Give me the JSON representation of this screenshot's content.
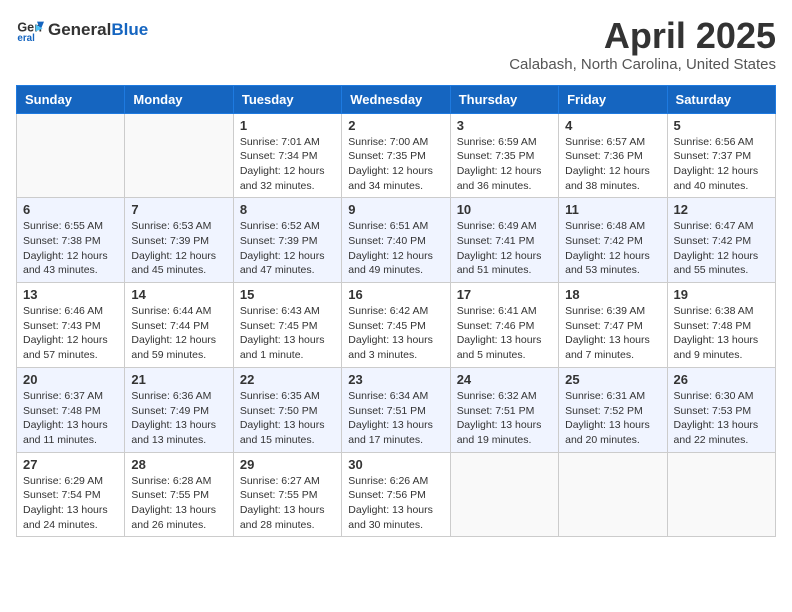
{
  "header": {
    "logo_general": "General",
    "logo_blue": "Blue",
    "title": "April 2025",
    "subtitle": "Calabash, North Carolina, United States"
  },
  "calendar": {
    "days_of_week": [
      "Sunday",
      "Monday",
      "Tuesday",
      "Wednesday",
      "Thursday",
      "Friday",
      "Saturday"
    ],
    "weeks": [
      [
        {
          "day": "",
          "info": ""
        },
        {
          "day": "",
          "info": ""
        },
        {
          "day": "1",
          "info": "Sunrise: 7:01 AM\nSunset: 7:34 PM\nDaylight: 12 hours\nand 32 minutes."
        },
        {
          "day": "2",
          "info": "Sunrise: 7:00 AM\nSunset: 7:35 PM\nDaylight: 12 hours\nand 34 minutes."
        },
        {
          "day": "3",
          "info": "Sunrise: 6:59 AM\nSunset: 7:35 PM\nDaylight: 12 hours\nand 36 minutes."
        },
        {
          "day": "4",
          "info": "Sunrise: 6:57 AM\nSunset: 7:36 PM\nDaylight: 12 hours\nand 38 minutes."
        },
        {
          "day": "5",
          "info": "Sunrise: 6:56 AM\nSunset: 7:37 PM\nDaylight: 12 hours\nand 40 minutes."
        }
      ],
      [
        {
          "day": "6",
          "info": "Sunrise: 6:55 AM\nSunset: 7:38 PM\nDaylight: 12 hours\nand 43 minutes."
        },
        {
          "day": "7",
          "info": "Sunrise: 6:53 AM\nSunset: 7:39 PM\nDaylight: 12 hours\nand 45 minutes."
        },
        {
          "day": "8",
          "info": "Sunrise: 6:52 AM\nSunset: 7:39 PM\nDaylight: 12 hours\nand 47 minutes."
        },
        {
          "day": "9",
          "info": "Sunrise: 6:51 AM\nSunset: 7:40 PM\nDaylight: 12 hours\nand 49 minutes."
        },
        {
          "day": "10",
          "info": "Sunrise: 6:49 AM\nSunset: 7:41 PM\nDaylight: 12 hours\nand 51 minutes."
        },
        {
          "day": "11",
          "info": "Sunrise: 6:48 AM\nSunset: 7:42 PM\nDaylight: 12 hours\nand 53 minutes."
        },
        {
          "day": "12",
          "info": "Sunrise: 6:47 AM\nSunset: 7:42 PM\nDaylight: 12 hours\nand 55 minutes."
        }
      ],
      [
        {
          "day": "13",
          "info": "Sunrise: 6:46 AM\nSunset: 7:43 PM\nDaylight: 12 hours\nand 57 minutes."
        },
        {
          "day": "14",
          "info": "Sunrise: 6:44 AM\nSunset: 7:44 PM\nDaylight: 12 hours\nand 59 minutes."
        },
        {
          "day": "15",
          "info": "Sunrise: 6:43 AM\nSunset: 7:45 PM\nDaylight: 13 hours\nand 1 minute."
        },
        {
          "day": "16",
          "info": "Sunrise: 6:42 AM\nSunset: 7:45 PM\nDaylight: 13 hours\nand 3 minutes."
        },
        {
          "day": "17",
          "info": "Sunrise: 6:41 AM\nSunset: 7:46 PM\nDaylight: 13 hours\nand 5 minutes."
        },
        {
          "day": "18",
          "info": "Sunrise: 6:39 AM\nSunset: 7:47 PM\nDaylight: 13 hours\nand 7 minutes."
        },
        {
          "day": "19",
          "info": "Sunrise: 6:38 AM\nSunset: 7:48 PM\nDaylight: 13 hours\nand 9 minutes."
        }
      ],
      [
        {
          "day": "20",
          "info": "Sunrise: 6:37 AM\nSunset: 7:48 PM\nDaylight: 13 hours\nand 11 minutes."
        },
        {
          "day": "21",
          "info": "Sunrise: 6:36 AM\nSunset: 7:49 PM\nDaylight: 13 hours\nand 13 minutes."
        },
        {
          "day": "22",
          "info": "Sunrise: 6:35 AM\nSunset: 7:50 PM\nDaylight: 13 hours\nand 15 minutes."
        },
        {
          "day": "23",
          "info": "Sunrise: 6:34 AM\nSunset: 7:51 PM\nDaylight: 13 hours\nand 17 minutes."
        },
        {
          "day": "24",
          "info": "Sunrise: 6:32 AM\nSunset: 7:51 PM\nDaylight: 13 hours\nand 19 minutes."
        },
        {
          "day": "25",
          "info": "Sunrise: 6:31 AM\nSunset: 7:52 PM\nDaylight: 13 hours\nand 20 minutes."
        },
        {
          "day": "26",
          "info": "Sunrise: 6:30 AM\nSunset: 7:53 PM\nDaylight: 13 hours\nand 22 minutes."
        }
      ],
      [
        {
          "day": "27",
          "info": "Sunrise: 6:29 AM\nSunset: 7:54 PM\nDaylight: 13 hours\nand 24 minutes."
        },
        {
          "day": "28",
          "info": "Sunrise: 6:28 AM\nSunset: 7:55 PM\nDaylight: 13 hours\nand 26 minutes."
        },
        {
          "day": "29",
          "info": "Sunrise: 6:27 AM\nSunset: 7:55 PM\nDaylight: 13 hours\nand 28 minutes."
        },
        {
          "day": "30",
          "info": "Sunrise: 6:26 AM\nSunset: 7:56 PM\nDaylight: 13 hours\nand 30 minutes."
        },
        {
          "day": "",
          "info": ""
        },
        {
          "day": "",
          "info": ""
        },
        {
          "day": "",
          "info": ""
        }
      ]
    ]
  }
}
